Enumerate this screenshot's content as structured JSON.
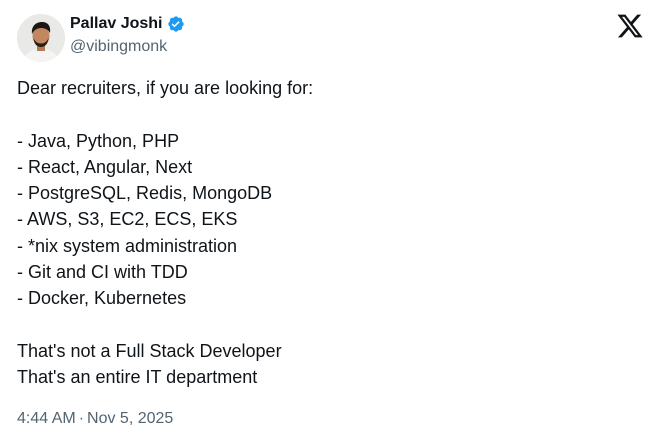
{
  "author": {
    "display_name": "Pallav Joshi",
    "handle": "@vibingmonk",
    "verified": true,
    "verified_color": "#1d9bf0",
    "avatar_icon": "avatar-photo"
  },
  "brand": {
    "logo_icon": "x-logo-icon",
    "logo_color": "#0f1419"
  },
  "tweet": {
    "intro": "Dear recruiters, if you are looking for:",
    "list": [
      "- Java, Python, PHP",
      "- React, Angular, Next",
      "- PostgreSQL, Redis, MongoDB",
      "- AWS, S3, EC2, ECS, EKS",
      "- *nix system administration",
      "- Git and CI with TDD",
      "- Docker, Kubernetes"
    ],
    "outro": [
      "That's not a Full Stack Developer",
      "That's an entire IT department"
    ]
  },
  "meta": {
    "time": "4:44 AM",
    "separator": "·",
    "date": "Nov 5, 2025"
  }
}
